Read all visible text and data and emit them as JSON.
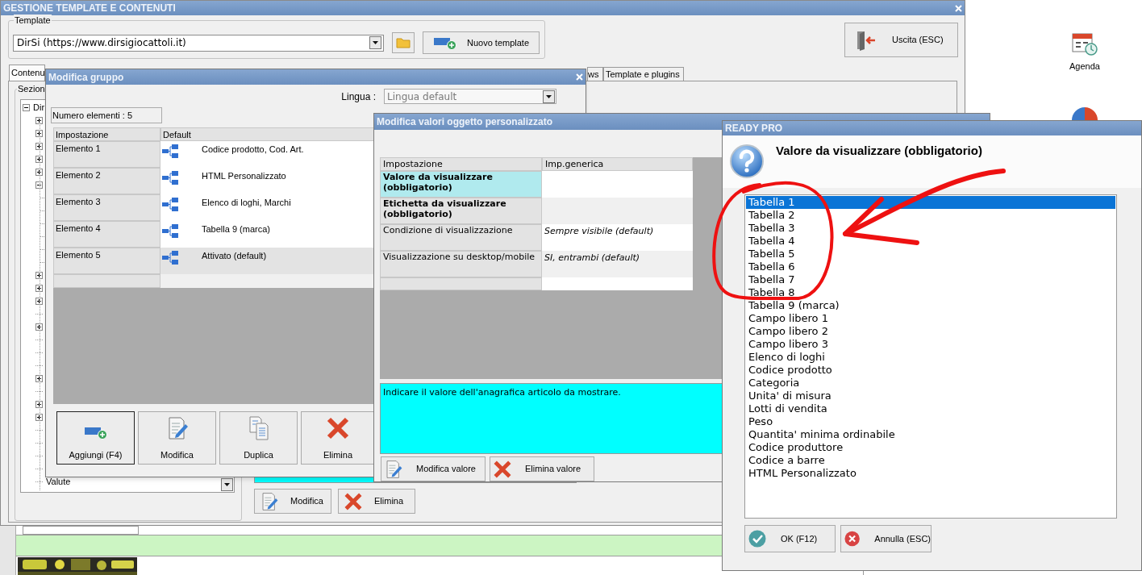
{
  "main_window": {
    "title": "GESTIONE TEMPLATE E CONTENUTI",
    "template_group": {
      "label": "Template",
      "value": "DirSi (https://www.dirsigiocattoli.it)",
      "new_button": "Nuovo template"
    },
    "exit_button": "Uscita (ESC)",
    "tabs": [
      {
        "label": "Contenu",
        "selected": true
      },
      {
        "label": "ws",
        "selected": false
      },
      {
        "label": "Template e plugins",
        "selected": false
      }
    ],
    "section_group": {
      "label": "Sezion",
      "tree": {
        "label": "Dir",
        "expanded": true,
        "children": [
          {
            "kind": "folder",
            "expanded": false
          },
          {
            "kind": "folder",
            "expanded": false
          },
          {
            "kind": "folder",
            "expanded": false
          },
          {
            "kind": "folder",
            "expanded": false
          },
          {
            "kind": "folder",
            "expanded": false
          },
          {
            "kind": "folder",
            "expanded": true,
            "children": [
              {
                "kind": "leaf"
              },
              {
                "kind": "leaf"
              },
              {
                "kind": "leaf"
              },
              {
                "kind": "leaf"
              },
              {
                "kind": "leaf"
              },
              {
                "kind": "leaf"
              }
            ]
          },
          {
            "kind": "folder",
            "expanded": false
          },
          {
            "kind": "folder",
            "expanded": false
          },
          {
            "kind": "folder",
            "expanded": false
          },
          {
            "kind": "leaf"
          },
          {
            "kind": "folder",
            "expanded": false
          },
          {
            "kind": "leaf"
          },
          {
            "kind": "leaf"
          },
          {
            "kind": "leaf"
          },
          {
            "kind": "folder",
            "expanded": false
          },
          {
            "kind": "leaf"
          },
          {
            "kind": "folder",
            "expanded": false
          },
          {
            "kind": "folder",
            "expanded": false
          },
          {
            "kind": "leaf"
          },
          {
            "kind": "leaf"
          },
          {
            "kind": "leaf"
          },
          {
            "kind": "leaf"
          },
          {
            "kind": "leaf",
            "label": "Valute"
          }
        ]
      }
    },
    "buttons": [
      {
        "label": "Modifica",
        "kind": "edit"
      },
      {
        "label": "Elimina",
        "kind": "delete"
      }
    ]
  },
  "desktop": {
    "icons": [
      {
        "label": "Agenda",
        "kind": "calendar"
      }
    ]
  },
  "group_dialog": {
    "title": "Modifica gruppo",
    "language_label": "Lingua :",
    "language": "Lingua default",
    "count": "Numero elementi : 5",
    "columns": [
      "Impostazione",
      "Default"
    ],
    "rows": [
      {
        "setting": "Elemento 1",
        "value": "Codice prodotto, Cod. Art.",
        "selected": false
      },
      {
        "setting": "Elemento 2",
        "value": "HTML Personalizzato",
        "selected": false
      },
      {
        "setting": "Elemento 3",
        "value": "Elenco di loghi, Marchi",
        "selected": false
      },
      {
        "setting": "Elemento 4",
        "value": "Tabella 9 (marca)",
        "selected": false
      },
      {
        "setting": "Elemento 5",
        "value": "Attivato (default)",
        "selected": true
      }
    ],
    "buttons": [
      {
        "label": "Aggiungi (F4)",
        "kind": "add",
        "focused": true
      },
      {
        "label": "Modifica",
        "kind": "edit",
        "focused": false
      },
      {
        "label": "Duplica",
        "kind": "duplicate",
        "focused": false
      },
      {
        "label": "Elimina",
        "kind": "delete",
        "focused": false
      }
    ]
  },
  "values_dialog": {
    "title": "Modifica valori oggetto personalizzato",
    "columns": [
      "Impostazione",
      "Imp.generica"
    ],
    "rows": [
      {
        "setting": "Valore da visualizzare (obbligatorio)",
        "required": true,
        "selected": true
      },
      {
        "setting": "Etichetta da visualizzare (obbligatorio)",
        "required": true,
        "selected": false
      },
      {
        "setting": "Condizione di visualizzazione",
        "value": "Sempre visibile (default)",
        "required": false,
        "selected": false
      },
      {
        "setting": "Visualizzazione su desktop/mobile",
        "value": "SI, entrambi (default)",
        "required": false,
        "selected": false
      }
    ],
    "description": "Indicare il valore dell'anagrafica articolo da mostrare.",
    "buttons": [
      {
        "label": "Modifica valore",
        "kind": "edit"
      },
      {
        "label": "Elimina valore",
        "kind": "delete"
      }
    ]
  },
  "choice_dialog": {
    "title": "READY PRO",
    "heading": "Valore da visualizzare (obbligatorio)",
    "items": [
      {
        "label": "Tabella 1",
        "selected": true
      },
      {
        "label": "Tabella 2",
        "selected": false
      },
      {
        "label": "Tabella 3",
        "selected": false
      },
      {
        "label": "Tabella 4",
        "selected": false
      },
      {
        "label": "Tabella 5",
        "selected": false
      },
      {
        "label": "Tabella 6",
        "selected": false
      },
      {
        "label": "Tabella 7",
        "selected": false
      },
      {
        "label": "Tabella 8",
        "selected": false
      },
      {
        "label": "Tabella 9 (marca)",
        "selected": false
      },
      {
        "label": "Campo libero 1",
        "selected": false
      },
      {
        "label": "Campo libero 2",
        "selected": false
      },
      {
        "label": "Campo libero 3",
        "selected": false
      },
      {
        "label": "Elenco di loghi",
        "selected": false
      },
      {
        "label": "Codice prodotto",
        "selected": false
      },
      {
        "label": "Categoria",
        "selected": false
      },
      {
        "label": "Unita' di misura",
        "selected": false
      },
      {
        "label": "Lotti di vendita",
        "selected": false
      },
      {
        "label": "Peso",
        "selected": false
      },
      {
        "label": "Quantita' minima ordinabile",
        "selected": false
      },
      {
        "label": "Codice produttore",
        "selected": false
      },
      {
        "label": "Codice a barre",
        "selected": false
      },
      {
        "label": "HTML Personalizzato",
        "selected": false
      }
    ],
    "buttons": [
      {
        "label": "OK (F12)",
        "kind": "ok"
      },
      {
        "label": "Annulla (ESC)",
        "kind": "cancel"
      }
    ]
  }
}
